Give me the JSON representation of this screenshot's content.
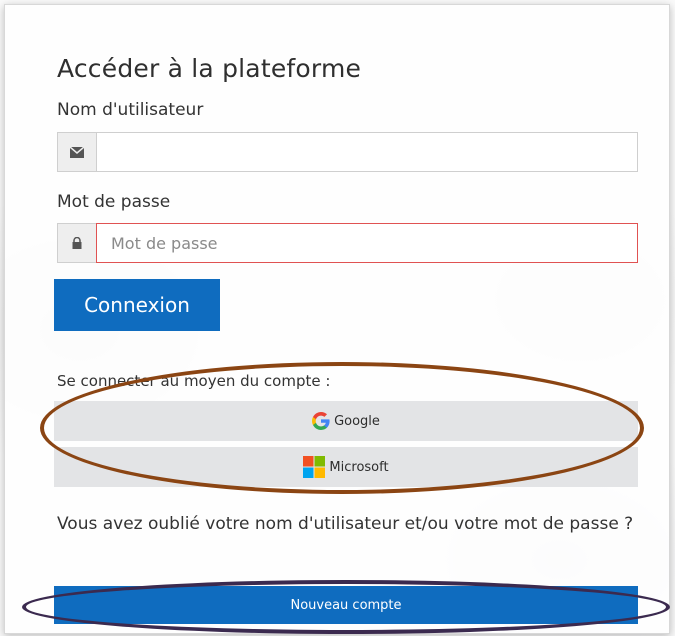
{
  "login": {
    "title": "Accéder à la plateforme",
    "username_label": "Nom d'utilisateur",
    "username_value": "",
    "password_label": "Mot de passe",
    "password_placeholder": "Mot de passe",
    "login_button": "Connexion",
    "sso_prompt": "Se connecter au moyen du compte :",
    "sso": [
      {
        "label": "Google",
        "icon": "google-icon"
      },
      {
        "label": "Microsoft",
        "icon": "microsoft-icon"
      }
    ],
    "forgot_link": "Vous avez oublié votre nom d'utilisateur et/ou votre mot de passe ?",
    "new_account_button": "Nouveau compte"
  },
  "annotations": {
    "brown_ellipse_color": "#8b4513",
    "purple_ellipse_color": "#3b2a4f"
  },
  "colors": {
    "primary": "#0f6cbf",
    "error_border": "#e05252",
    "sso_bg": "#e3e4e6"
  }
}
